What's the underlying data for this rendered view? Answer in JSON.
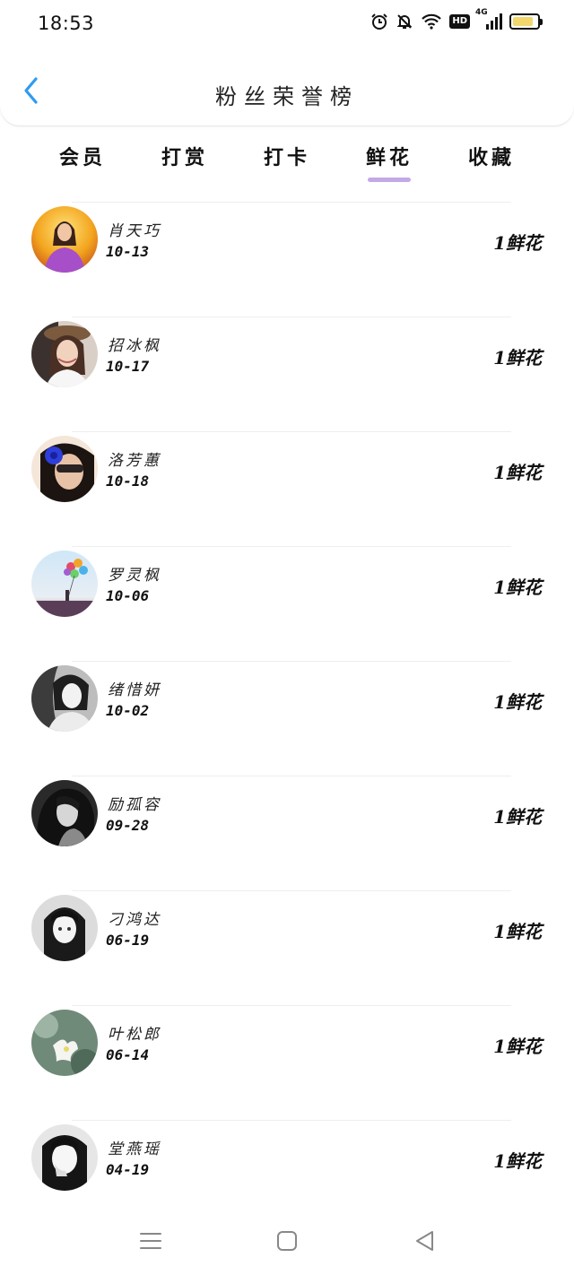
{
  "status_bar": {
    "time": "18:53",
    "hd_label": "HD",
    "network_label": "4G",
    "battery_level_pct": 85,
    "battery_color": "#f2d76d"
  },
  "header": {
    "title": "粉丝荣誉榜",
    "back_icon": "chevron-left-icon",
    "accent_color": "#2f9bf0"
  },
  "tabs": {
    "active_index": 3,
    "indicator_color": "#c3a9e6",
    "items": [
      {
        "label": "会员"
      },
      {
        "label": "打赏"
      },
      {
        "label": "打卡"
      },
      {
        "label": "鲜花"
      },
      {
        "label": "收藏"
      }
    ]
  },
  "fans": [
    {
      "name": "肖天巧",
      "date": "10-13",
      "count": "1鲜花"
    },
    {
      "name": "招冰枫",
      "date": "10-17",
      "count": "1鲜花"
    },
    {
      "name": "洛芳蕙",
      "date": "10-18",
      "count": "1鲜花"
    },
    {
      "name": "罗灵枫",
      "date": "10-06",
      "count": "1鲜花"
    },
    {
      "name": "绪惜妍",
      "date": "10-02",
      "count": "1鲜花"
    },
    {
      "name": "励孤容",
      "date": "09-28",
      "count": "1鲜花"
    },
    {
      "name": "刁鸿达",
      "date": "06-19",
      "count": "1鲜花"
    },
    {
      "name": "叶松郎",
      "date": "06-14",
      "count": "1鲜花"
    },
    {
      "name": "堂燕瑶",
      "date": "04-19",
      "count": "1鲜花"
    }
  ],
  "nav_bar": {
    "menu_icon": "menu-icon",
    "home_icon": "home-square-icon",
    "back_icon": "back-triangle-icon"
  }
}
